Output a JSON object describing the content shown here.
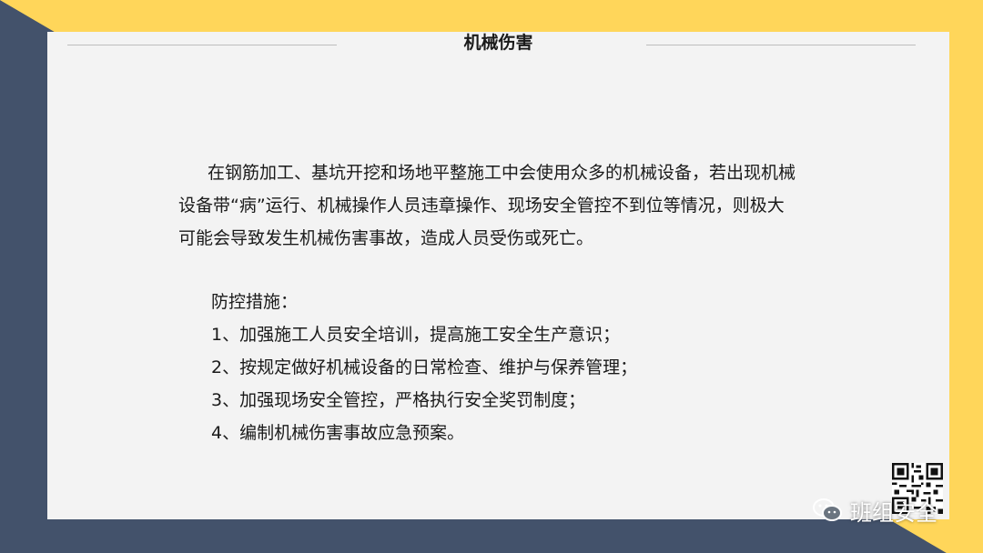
{
  "slide": {
    "title": "机械伤害",
    "paragraph": "在钢筋加工、基坑开挖和场地平整施工中会使用众多的机械设备，若出现机械设备带“病”运行、机械操作人员违章操作、现场安全管控不到位等情况，则极大可能会导致发生机械伤害事故，造成人员受伤或死亡。",
    "measures_heading": "防控措施：",
    "measures": [
      "1、加强施工人员安全培训，提高施工安全生产意识；",
      "2、按规定做好机械设备的日常检查、维护与保养管理；",
      "3、加强现场安全管控，严格执行安全奖罚制度；",
      "4、编制机械伤害事故应急预案。"
    ]
  },
  "watermark": {
    "text": "班组安全",
    "icon": "wechat-icon"
  },
  "colors": {
    "navy": "#43526b",
    "yellow": "#ffd65a",
    "slide_bg": "#f3f3f3"
  }
}
